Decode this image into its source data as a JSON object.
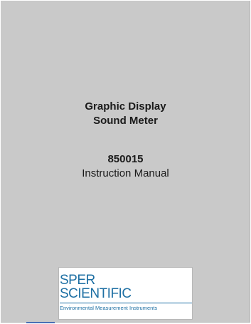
{
  "document": {
    "title_line1": "Graphic Display",
    "title_line2": "Sound Meter",
    "model_number": "850015",
    "subtitle": "Instruction Manual"
  },
  "logo": {
    "line1": "SPER",
    "line2": "SCIENTIFIC",
    "tagline": "Environmental Measurement Instruments",
    "color": "#1d6fa3"
  },
  "colors": {
    "page_background": "#c9c9c9",
    "text": "#1a1a1a"
  }
}
